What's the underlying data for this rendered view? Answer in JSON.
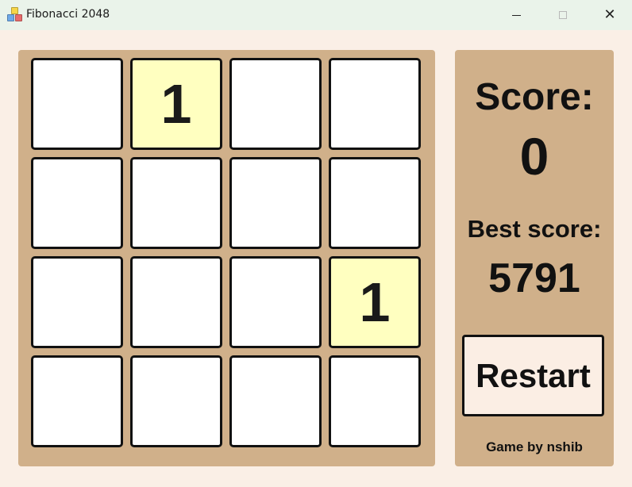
{
  "window": {
    "title": "Fibonacci 2048",
    "minimize_glyph": "",
    "maximize_glyph": "",
    "close_glyph": "✕"
  },
  "board": {
    "rows": [
      [
        "",
        "1",
        "",
        ""
      ],
      [
        "",
        "",
        "",
        ""
      ],
      [
        "",
        "",
        "",
        "1"
      ],
      [
        "",
        "",
        "",
        ""
      ]
    ],
    "filled_tile_color": "#ffffc0",
    "empty_tile_color": "#ffffff"
  },
  "panel": {
    "score_label": "Score:",
    "score_value": "0",
    "best_label": "Best score:",
    "best_value": "5791",
    "restart_label": "Restart",
    "credit": "Game by nshib"
  },
  "colors": {
    "board_bg": "#d0b08a",
    "page_bg": "#faefe6",
    "titlebar_bg": "#eaf3ea"
  }
}
